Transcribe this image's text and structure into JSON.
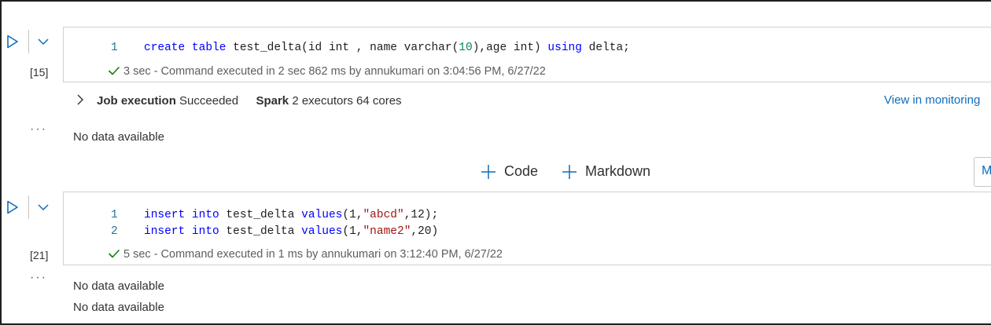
{
  "cells": [
    {
      "exec_count": "[15]",
      "lines": [
        {
          "num": "1"
        }
      ],
      "status": {
        "duration": "3 sec",
        "message": " - Command executed in 2 sec 862 ms by annukumari on 3:04:56 PM, 6/27/22"
      },
      "job": {
        "label": "Job execution",
        "state": "Succeeded",
        "spark_label": "Spark",
        "spark_info": "2 executors 64 cores",
        "monitor_link": "View in monitoring"
      },
      "ellipsis": "···",
      "outputs": [
        "No data available"
      ]
    },
    {
      "exec_count": "[21]",
      "lines": [
        {
          "num": "1"
        },
        {
          "num": "2"
        }
      ],
      "status": {
        "duration": "5 sec",
        "message": " - Command executed in 1 ms by annukumari on 3:12:40 PM, 6/27/22"
      },
      "ellipsis": "···",
      "outputs": [
        "No data available",
        "No data available"
      ]
    }
  ],
  "code": {
    "c1l1": [
      "create",
      " ",
      "table",
      " test_delta(id int , name varchar(",
      "10",
      "),age int) ",
      "using",
      " delta;"
    ],
    "c2l1": [
      "insert",
      " ",
      "into",
      " test_delta ",
      "values",
      "(1,",
      "\"abcd\"",
      ",12);"
    ],
    "c2l2": [
      "insert",
      " ",
      "into",
      " test_delta ",
      "values",
      "(1,",
      "\"name2\"",
      ",20)"
    ]
  },
  "add_bar": {
    "code_label": "Code",
    "markdown_label": "Markdown",
    "side_button_label": "M"
  },
  "colors": {
    "keyword": "#0000ff",
    "number": "#098658",
    "string": "#a31515",
    "check": "#107c10",
    "link": "#0f6cbd",
    "run_icon": "#0f6cbd"
  }
}
